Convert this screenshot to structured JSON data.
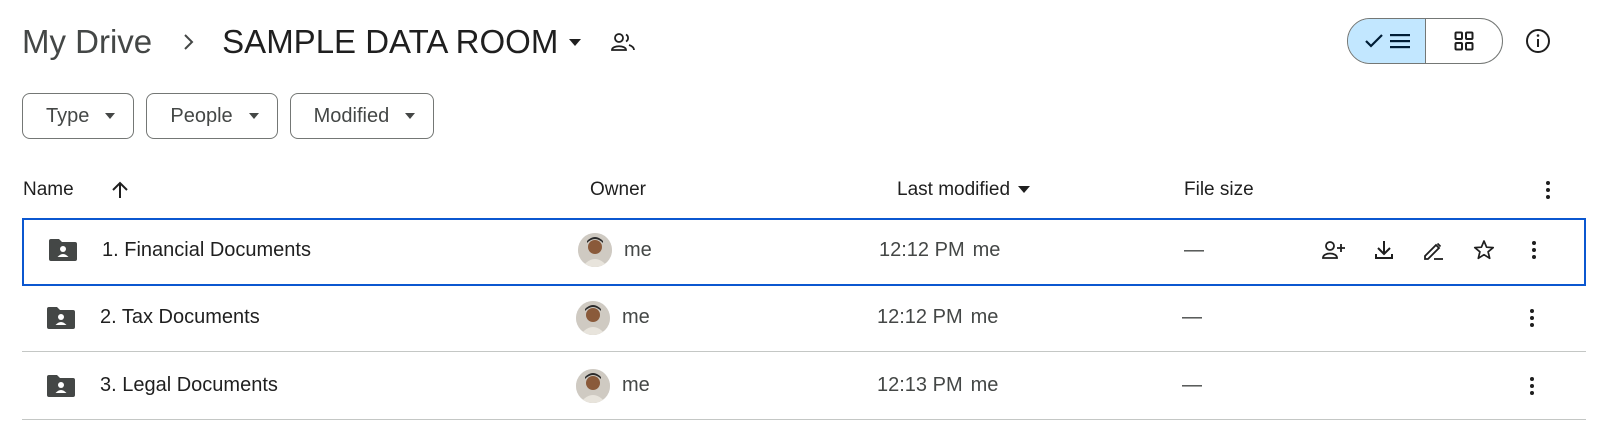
{
  "breadcrumb": {
    "root": "My Drive",
    "current": "SAMPLE DATA ROOM"
  },
  "view_toggle": {
    "selected": "list"
  },
  "filters": [
    {
      "label": "Type"
    },
    {
      "label": "People"
    },
    {
      "label": "Modified"
    }
  ],
  "columns": {
    "name": "Name",
    "owner": "Owner",
    "last_modified": "Last modified",
    "file_size": "File size"
  },
  "rows": [
    {
      "name": "1. Financial Documents",
      "owner": "me",
      "time": "12:12 PM",
      "modified_by": "me",
      "size": "—"
    },
    {
      "name": "2. Tax Documents",
      "owner": "me",
      "time": "12:12 PM",
      "modified_by": "me",
      "size": "—"
    },
    {
      "name": "3. Legal Documents",
      "owner": "me",
      "time": "12:13 PM",
      "modified_by": "me",
      "size": "—"
    }
  ],
  "colors": {
    "accent": "#0b57d0",
    "toggle_selected": "#c2e7ff",
    "divider": "#c4c7c5"
  },
  "icons": [
    "chevron-right-icon",
    "caret-down-icon",
    "shared-people-icon",
    "check-icon",
    "list-icon",
    "grid-icon",
    "info-icon",
    "arrow-up-icon",
    "more-vert-icon",
    "shared-folder-icon",
    "add-person-icon",
    "download-icon",
    "rename-icon",
    "star-icon"
  ]
}
